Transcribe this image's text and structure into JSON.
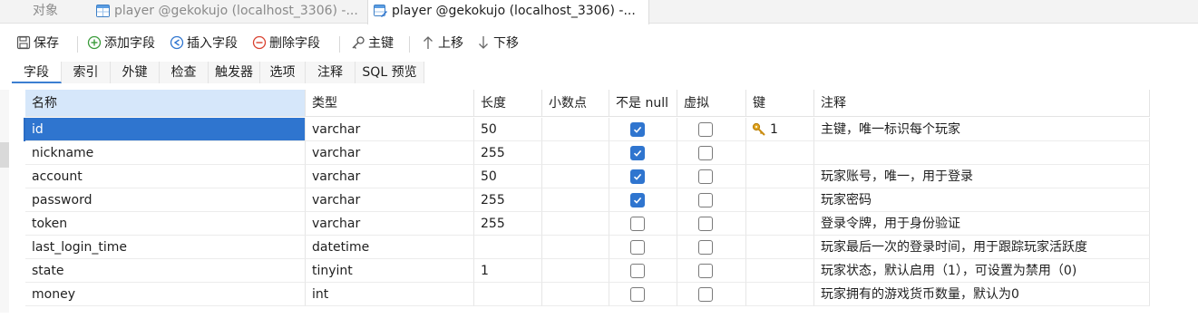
{
  "tabs": {
    "objects_label": "对象",
    "doc_tabs": [
      {
        "label": "player @gekokujo (localhost_3306) -..."
      },
      {
        "label": "player @gekokujo (localhost_3306) -..."
      }
    ]
  },
  "toolbar": {
    "save": "保存",
    "add_field": "添加字段",
    "insert_field": "插入字段",
    "delete_field": "删除字段",
    "primary_key": "主键",
    "move_up": "上移",
    "move_down": "下移"
  },
  "subtabs": [
    "字段",
    "索引",
    "外键",
    "检查",
    "触发器",
    "选项",
    "注释",
    "SQL 预览"
  ],
  "grid": {
    "headers": [
      "名称",
      "类型",
      "长度",
      "小数点",
      "不是 null",
      "虚拟",
      "键",
      "注释"
    ],
    "rows": [
      {
        "name": "id",
        "type": "varchar",
        "length": "50",
        "decimals": "",
        "not_null": true,
        "virtual": false,
        "key": "1",
        "comment": "主键，唯一标识每个玩家"
      },
      {
        "name": "nickname",
        "type": "varchar",
        "length": "255",
        "decimals": "",
        "not_null": true,
        "virtual": false,
        "key": "",
        "comment": ""
      },
      {
        "name": "account",
        "type": "varchar",
        "length": "50",
        "decimals": "",
        "not_null": true,
        "virtual": false,
        "key": "",
        "comment": "玩家账号，唯一，用于登录"
      },
      {
        "name": "password",
        "type": "varchar",
        "length": "255",
        "decimals": "",
        "not_null": true,
        "virtual": false,
        "key": "",
        "comment": "玩家密码"
      },
      {
        "name": "token",
        "type": "varchar",
        "length": "255",
        "decimals": "",
        "not_null": false,
        "virtual": false,
        "key": "",
        "comment": "登录令牌，用于身份验证"
      },
      {
        "name": "last_login_time",
        "type": "datetime",
        "length": "",
        "decimals": "",
        "not_null": false,
        "virtual": false,
        "key": "",
        "comment": "玩家最后一次的登录时间，用于跟踪玩家活跃度"
      },
      {
        "name": "state",
        "type": "tinyint",
        "length": "1",
        "decimals": "",
        "not_null": false,
        "virtual": false,
        "key": "",
        "comment": "玩家状态，默认启用（1），可设置为禁用（0)"
      },
      {
        "name": "money",
        "type": "int",
        "length": "",
        "decimals": "",
        "not_null": false,
        "virtual": false,
        "key": "",
        "comment": "玩家拥有的游戏货币数量，默认为0"
      }
    ]
  },
  "colors": {
    "accent": "#2f75cf",
    "header_selected": "#d6e7fa"
  }
}
